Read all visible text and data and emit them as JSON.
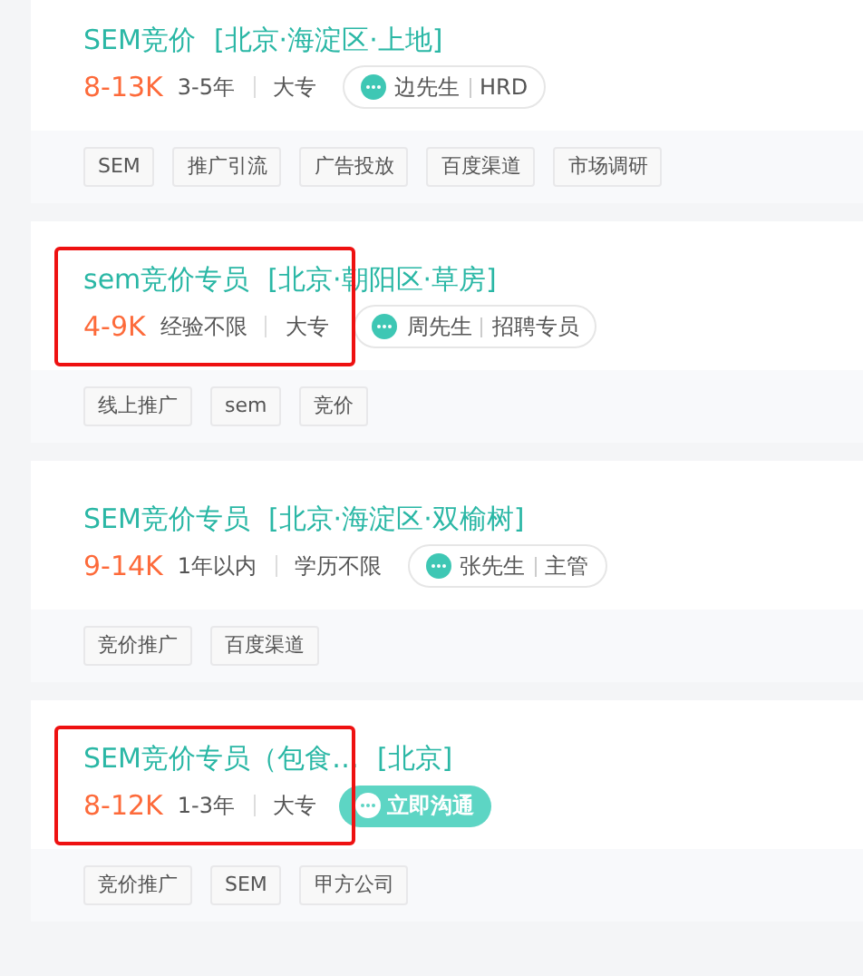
{
  "jobs": [
    {
      "title": "SEM竞价",
      "location": "[北京·海淀区·上地]",
      "salary": "8-13K",
      "experience": "3-5年",
      "education": "大专",
      "highlighted": false,
      "contact": {
        "kind": "recruiter",
        "name": "边先生",
        "role": "HRD"
      },
      "tags": [
        "SEM",
        "推广引流",
        "广告投放",
        "百度渠道",
        "市场调研"
      ]
    },
    {
      "title": "sem竞价专员",
      "location": "[北京·朝阳区·草房]",
      "salary": "4-9K",
      "experience": "经验不限",
      "education": "大专",
      "highlighted": true,
      "contact": {
        "kind": "recruiter",
        "name": "周先生",
        "role": "招聘专员"
      },
      "tags": [
        "线上推广",
        "sem",
        "竞价"
      ]
    },
    {
      "title": "SEM竞价专员",
      "location": "[北京·海淀区·双榆树]",
      "salary": "9-14K",
      "experience": "1年以内",
      "education": "学历不限",
      "highlighted": false,
      "contact": {
        "kind": "recruiter",
        "name": "张先生",
        "role": "主管"
      },
      "tags": [
        "竞价推广",
        "百度渠道"
      ]
    },
    {
      "title": "SEM竞价专员（包食…",
      "location": "[北京]",
      "salary": "8-12K",
      "experience": "1-3年",
      "education": "大专",
      "highlighted": true,
      "contact": {
        "kind": "chat-button",
        "label": "立即沟通"
      },
      "tags": [
        "竞价推广",
        "SEM",
        "甲方公司"
      ]
    }
  ]
}
